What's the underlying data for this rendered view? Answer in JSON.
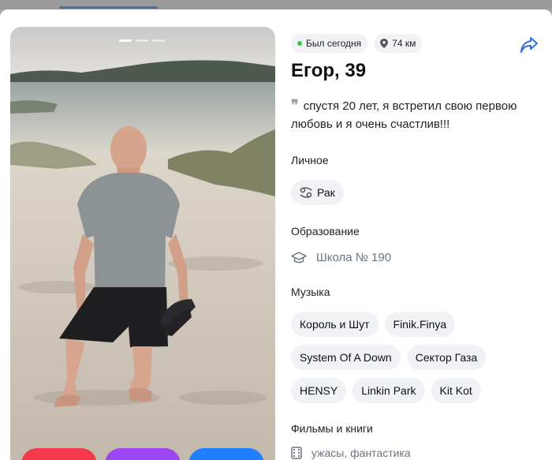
{
  "status": {
    "online": "Был сегодня",
    "distance": "74 км"
  },
  "profile": {
    "name": "Егор, 39",
    "quote": "спустя 20 лет, я встретил свою первою любовь и я очень счастлив!!!"
  },
  "personal": {
    "title": "Личное",
    "zodiac": "Рак"
  },
  "education": {
    "title": "Образование",
    "school": "Школа № 190"
  },
  "music": {
    "title": "Музыка",
    "items": [
      "Король и Шут",
      "Finik.Finya",
      "System Of A Down",
      "Сектор Газа",
      "HENSY",
      "Linkin Park",
      "Kit Kot"
    ]
  },
  "films": {
    "title": "Фильмы и книги",
    "value": "ужасы, фантастика"
  },
  "photo": {
    "current": 1,
    "total": 3
  },
  "colors": {
    "like": "#f23a4c",
    "superlike": "#9b46f0",
    "message": "#1f7fff",
    "online": "#33c758"
  },
  "icons": {
    "share": "share-icon",
    "location": "location-pin-icon",
    "education": "graduation-cap-icon",
    "zodiac": "cancer-zodiac-icon",
    "films": "film-icon"
  }
}
